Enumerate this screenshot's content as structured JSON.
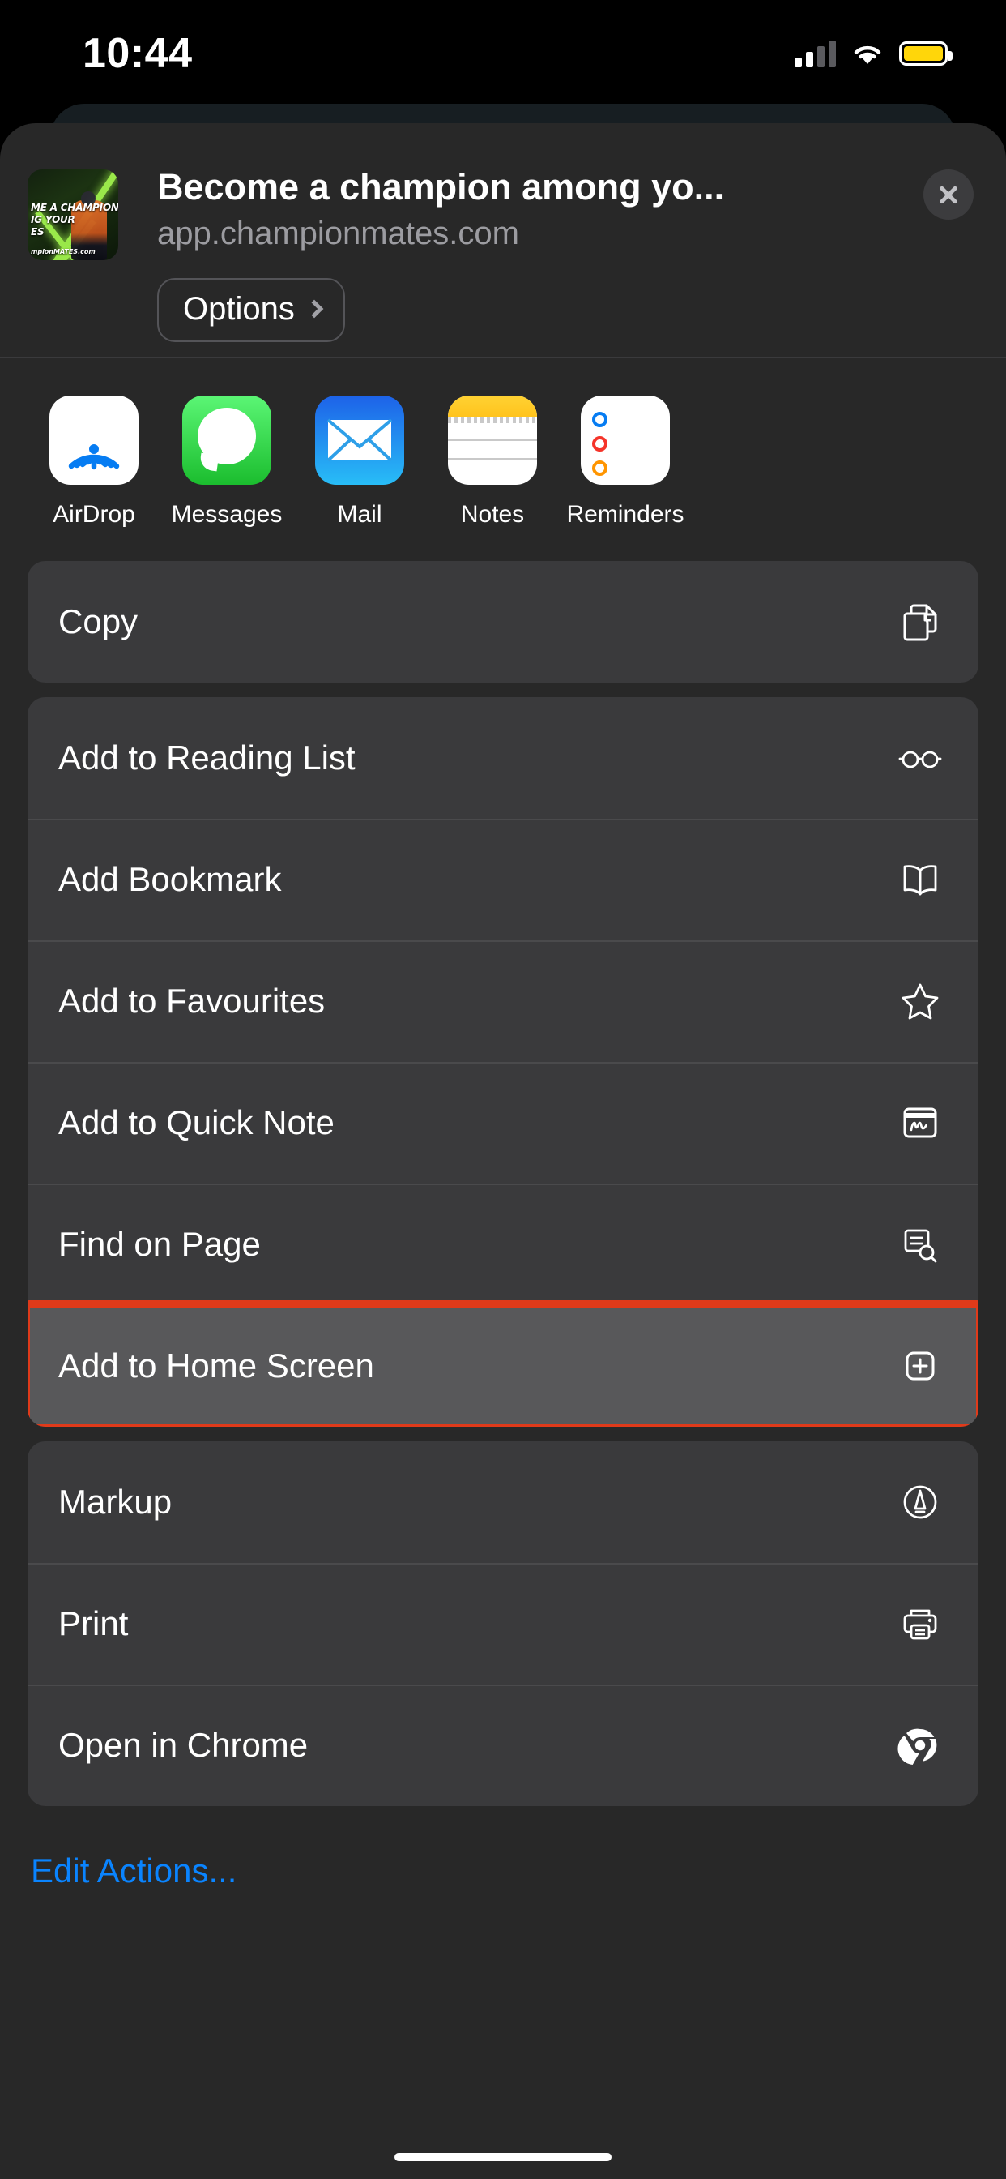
{
  "status_bar": {
    "time": "10:44",
    "cellular_icon": "cellular-bars-icon",
    "wifi_icon": "wifi-icon",
    "battery_icon": "battery-icon",
    "battery_color": "#ffd60a"
  },
  "share_sheet": {
    "preview": {
      "title": "Become a champion among yo...",
      "url": "app.championmates.com",
      "thumbnail_line1": "ME A CHAMPION",
      "thumbnail_line2": "IG YOUR",
      "thumbnail_line3": "ES",
      "thumbnail_url": "mpionMATES.com",
      "options_label": "Options",
      "options_chevron_icon": "chevron-right-icon",
      "close_icon": "close-icon"
    },
    "apps": [
      {
        "label": "AirDrop",
        "icon": "airdrop-icon"
      },
      {
        "label": "Messages",
        "icon": "messages-icon"
      },
      {
        "label": "Mail",
        "icon": "mail-icon"
      },
      {
        "label": "Notes",
        "icon": "notes-icon"
      },
      {
        "label": "Reminders",
        "icon": "reminders-icon"
      }
    ],
    "groups": [
      {
        "rows": [
          {
            "label": "Copy",
            "icon": "doc-on-doc-icon",
            "highlighted": false
          }
        ]
      },
      {
        "rows": [
          {
            "label": "Add to Reading List",
            "icon": "eyeglasses-icon",
            "highlighted": false
          },
          {
            "label": "Add Bookmark",
            "icon": "book-icon",
            "highlighted": false
          },
          {
            "label": "Add to Favourites",
            "icon": "star-icon",
            "highlighted": false
          },
          {
            "label": "Add to Quick Note",
            "icon": "quick-note-icon",
            "highlighted": false
          },
          {
            "label": "Find on Page",
            "icon": "doc-search-icon",
            "highlighted": false
          },
          {
            "label": "Add to Home Screen",
            "icon": "plus-square-icon",
            "highlighted": true
          }
        ]
      },
      {
        "rows": [
          {
            "label": "Markup",
            "icon": "markup-pen-icon",
            "highlighted": false
          },
          {
            "label": "Print",
            "icon": "printer-icon",
            "highlighted": false
          },
          {
            "label": "Open in Chrome",
            "icon": "chrome-icon",
            "highlighted": false
          }
        ]
      }
    ],
    "edit_actions_label": "Edit Actions...",
    "accent_color": "#0a84ff",
    "highlight_color": "#e03a1a"
  }
}
